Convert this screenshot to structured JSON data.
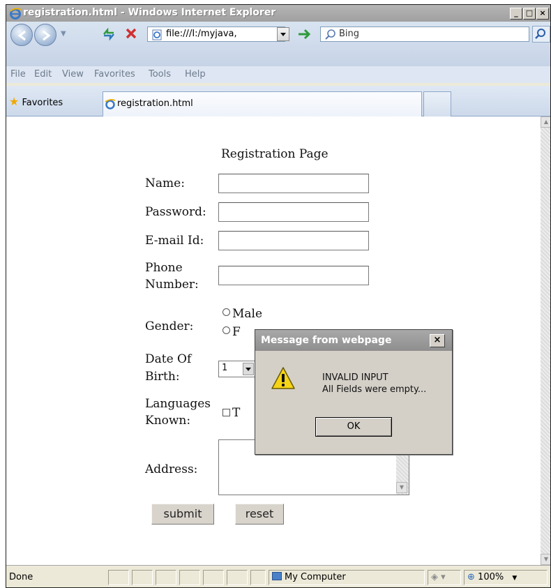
{
  "window": {
    "title": "registration.html - Windows Internet Explorer",
    "minimize": "_",
    "maximize": "□",
    "close": "×"
  },
  "toolbar": {
    "address": "file:///I:/myjava,",
    "search_placeholder": "Bing"
  },
  "menu": [
    "File",
    "Edit",
    "View",
    "Favorites",
    "Tools",
    "Help"
  ],
  "favorites_label": "Favorites",
  "tab_title": "registration.html",
  "page": {
    "heading": "Registration Page",
    "name_label": "Name:",
    "password_label": "Password:",
    "email_label": "E-mail Id:",
    "phone_label_line1": "Phone",
    "phone_label_line2": "Number:",
    "gender_label": "Gender:",
    "gender_male": "Male",
    "gender_female_partial": "F",
    "dob_label_line1": "Date Of",
    "dob_label_line2": "Birth:",
    "dob_day": "1",
    "languages_label_line1": "Languages",
    "languages_label_line2": "Known:",
    "language_first_partial": "T",
    "address_label": "Address:",
    "submit": "submit",
    "reset": "reset"
  },
  "dialog": {
    "title": "Message from webpage",
    "close": "×",
    "line1": "INVALID INPUT",
    "line2": "All Fields were empty...",
    "ok": "OK"
  },
  "status": {
    "left": "Done",
    "zone": "My Computer",
    "zoom": "100%"
  }
}
